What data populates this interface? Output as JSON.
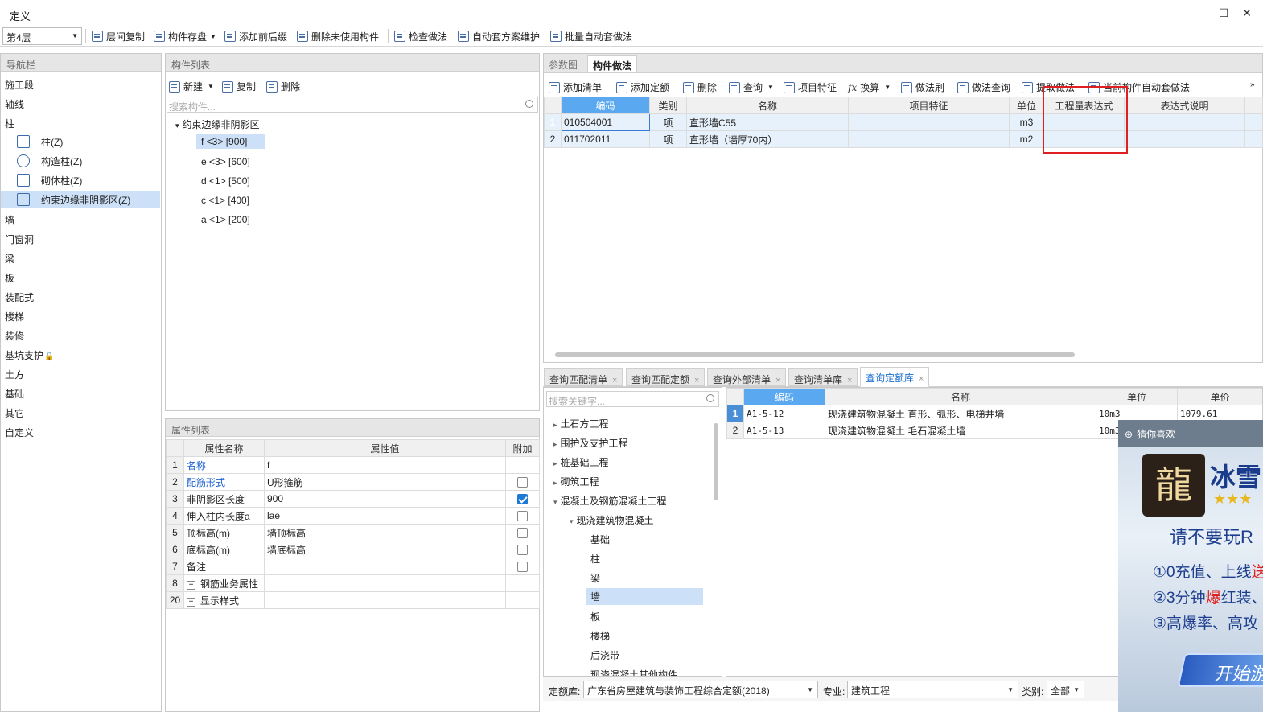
{
  "window": {
    "title": "定义",
    "min": "—",
    "max": "☐",
    "close": "✕"
  },
  "toolbar": {
    "floor": "第4层",
    "buttons": [
      "层间复制",
      "构件存盘",
      "添加前后缀",
      "删除未使用构件",
      "检查做法",
      "自动套方案维护",
      "批量自动套做法"
    ]
  },
  "nav": {
    "title": "导航栏",
    "items": [
      "施工段",
      "轴线",
      "柱",
      "墙",
      "门窗洞",
      "梁",
      "板",
      "装配式",
      "楼梯",
      "装修",
      "基坑支护",
      "土方",
      "基础",
      "其它",
      "自定义"
    ],
    "sub": [
      "柱(Z)",
      "构造柱(Z)",
      "砌体柱(Z)",
      "约束边缘非阴影区(Z)"
    ]
  },
  "component_list": {
    "title": "构件列表",
    "new": "新建",
    "copy": "复制",
    "delete": "删除",
    "search_placeholder": "搜索构件...",
    "root": "约束边缘非阴影区",
    "items": [
      "f <3> [900]",
      "e <3> [600]",
      "d <1> [500]",
      "c <1> [400]",
      "a <1> [200]"
    ]
  },
  "props": {
    "title": "属性列表",
    "headers": [
      "属性名称",
      "属性值",
      "附加"
    ],
    "rows": [
      {
        "no": "1",
        "name": "名称",
        "value": "f",
        "blue": true,
        "cb": "none"
      },
      {
        "no": "2",
        "name": "配筋形式",
        "value": "U形箍筋",
        "blue": true,
        "cb": "off"
      },
      {
        "no": "3",
        "name": "非阴影区长度",
        "value": "900",
        "blue": false,
        "cb": "on"
      },
      {
        "no": "4",
        "name": "伸入柱内长度a",
        "value": "lae",
        "blue": false,
        "cb": "off"
      },
      {
        "no": "5",
        "name": "顶标高(m)",
        "value": "墙顶标高",
        "blue": false,
        "cb": "off"
      },
      {
        "no": "6",
        "name": "底标高(m)",
        "value": "墙底标高",
        "blue": false,
        "cb": "off"
      },
      {
        "no": "7",
        "name": "备注",
        "value": "",
        "blue": false,
        "cb": "off"
      },
      {
        "no": "8",
        "name": "钢筋业务属性",
        "value": "",
        "blue": false,
        "cb": "none",
        "plus": true
      },
      {
        "no": "20",
        "name": "显示样式",
        "value": "",
        "blue": false,
        "cb": "none",
        "plus": true
      }
    ]
  },
  "method": {
    "tabs": [
      "参数图",
      "构件做法"
    ],
    "commands": [
      "添加清单",
      "添加定额",
      "删除",
      "查询",
      "项目特征",
      "换算",
      "做法刷",
      "做法查询",
      "提取做法",
      "当前构件自动套做法"
    ],
    "headers": [
      "编码",
      "类别",
      "名称",
      "项目特征",
      "单位",
      "工程量表达式",
      "表达式说明"
    ],
    "rows": [
      {
        "no": "1",
        "code": "010504001",
        "type": "项",
        "name": "直形墙C55",
        "feature": "",
        "unit": "m3",
        "expr": "",
        "desc": ""
      },
      {
        "no": "2",
        "code": "011702011",
        "type": "项",
        "name": "直形墙（墙厚70内）",
        "feature": "",
        "unit": "m2",
        "expr": "",
        "desc": ""
      }
    ]
  },
  "query": {
    "tabs": [
      "查询匹配清单",
      "查询匹配定额",
      "查询外部清单",
      "查询清单库",
      "查询定额库"
    ],
    "search_placeholder": "搜索关键字...",
    "tree": [
      {
        "label": "土石方工程",
        "level": 0,
        "arrow": "▸"
      },
      {
        "label": "围护及支护工程",
        "level": 0,
        "arrow": "▸"
      },
      {
        "label": "桩基础工程",
        "level": 0,
        "arrow": "▸"
      },
      {
        "label": "砌筑工程",
        "level": 0,
        "arrow": "▸"
      },
      {
        "label": "混凝土及钢筋混凝土工程",
        "level": 0,
        "arrow": "▾"
      },
      {
        "label": "现浇建筑物混凝土",
        "level": 1,
        "arrow": "▾"
      },
      {
        "label": "基础",
        "level": 2,
        "arrow": ""
      },
      {
        "label": "柱",
        "level": 2,
        "arrow": ""
      },
      {
        "label": "梁",
        "level": 2,
        "arrow": ""
      },
      {
        "label": "墙",
        "level": 2,
        "arrow": "",
        "sel": true
      },
      {
        "label": "板",
        "level": 2,
        "arrow": ""
      },
      {
        "label": "楼梯",
        "level": 2,
        "arrow": ""
      },
      {
        "label": "后浇带",
        "level": 2,
        "arrow": ""
      },
      {
        "label": "现浇混凝土其他构件",
        "level": 2,
        "arrow": ""
      }
    ],
    "headers": [
      "编码",
      "名称",
      "单位",
      "单价"
    ],
    "rows": [
      {
        "no": "1",
        "code": "A1-5-12",
        "name": "现浇建筑物混凝土 直形、弧形、电梯井墙",
        "unit": "10m3",
        "price": "1079.61"
      },
      {
        "no": "2",
        "code": "A1-5-13",
        "name": "现浇建筑物混凝土 毛石混凝土墙",
        "unit": "10m3",
        "price": ""
      }
    ],
    "footer": {
      "lib_label": "定额库:",
      "lib_value": "广东省房屋建筑与装饰工程综合定额(2018)",
      "major_label": "专业:",
      "major_value": "建筑工程",
      "cat_label": "类别:",
      "cat_value": "全部"
    }
  },
  "ad": {
    "header": "猜你喜欢",
    "logo_char": "龍",
    "title": "冰雪",
    "stars": "★★★",
    "line1": "请不要玩R",
    "line2a": "①0充值、上线",
    "line2b": "送",
    "line3a": "②3分钟",
    "line3b": "爆",
    "line3c": "红装、",
    "line4": "③高爆率、高攻",
    "button": "开始游"
  }
}
